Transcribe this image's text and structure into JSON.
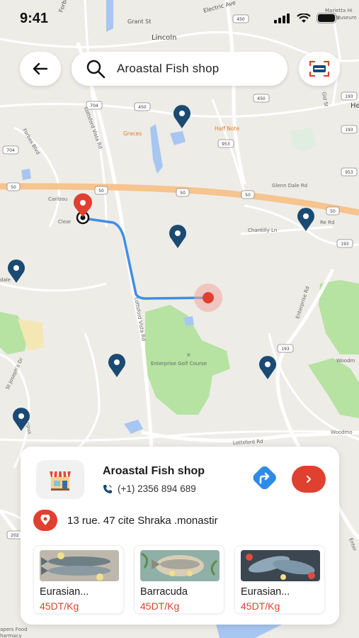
{
  "status_bar": {
    "time": "9:41"
  },
  "search": {
    "query": "Aroastal Fish shop"
  },
  "map": {
    "street_labels": [
      "Forbes",
      "Grant St",
      "Electric Ave",
      "Lincoln",
      "Marietta Hi",
      "Museum",
      "Graces",
      "Half Note",
      "Forbes Blvd",
      "Lottsford Vista Rd",
      "Glenn Dale Rd",
      "Caribou",
      "Clear",
      "Chantilly Ln",
      "Re Rd",
      "dale",
      "Enterprise Rd",
      "Lottsford Vista Rd",
      "Enterprise Golf Course",
      "St Joseph's Dr",
      "Woodm",
      "Woodmo",
      "Lottsford Rd",
      "Gid St",
      "He",
      "npus",
      "Enter",
      "apers Food",
      "harmacy"
    ],
    "shields": [
      "704",
      "450",
      "953",
      "193",
      "450",
      "704",
      "450",
      "953",
      "193",
      "50",
      "50",
      "50",
      "50",
      "50",
      "193",
      "193",
      "202"
    ]
  },
  "shop": {
    "name": "Aroastal Fish shop",
    "phone": "(+1) 2356 894 689",
    "address": "13 rue. 47 cite Shraka .monastir"
  },
  "products": [
    {
      "name": "Eurasian...",
      "price": "45DT/Kg"
    },
    {
      "name": "Barracuda",
      "price": "45DT/Kg"
    },
    {
      "name": "Eurasian...",
      "price": "45DT/Kg"
    }
  ],
  "colors": {
    "accent_red": "#e0402f",
    "pin_navy": "#1b4a72",
    "route_blue": "#3f8ee6",
    "direction_blue": "#2f8be6"
  },
  "icons": [
    "back-arrow-icon",
    "search-icon",
    "scan-icon",
    "shop-icon",
    "phone-icon",
    "directions-icon",
    "chevron-right-icon",
    "location-pin-icon"
  ]
}
